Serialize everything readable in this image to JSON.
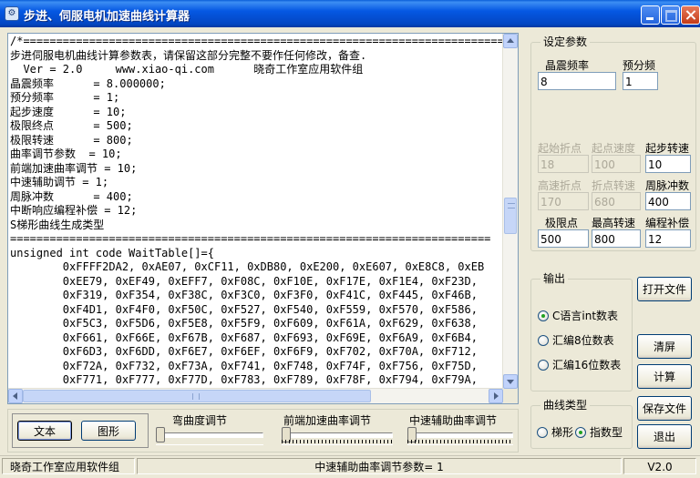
{
  "window": {
    "title": "步进、伺服电机加速曲线计算器"
  },
  "editor": {
    "content": "/*=========================================================================\n步进伺服电机曲线计算参数表，请保留这部分完整不要作任何修改，备查.\n  Ver = 2.0     www.xiao-qi.com      晓奇工作室应用软件组\n晶震频率      = 8.000000;\n预分频率      = 1;\n起步速度      = 10;\n极限终点      = 500;\n极限转速      = 800;\n曲率调节参数  = 10;\n前端加速曲率调节 = 10;\n中速辅助调节 = 1;\n周脉冲数      = 400;\n中断响应编程补偿 = 12;\nS梯形曲线生成类型\n=========================================================================\nunsigned int code WaitTable[]={\n        0xFFFF2DA2, 0xAE07, 0xCF11, 0xDB80, 0xE200, 0xE607, 0xE8C8, 0xEB\n        0xEE79, 0xEF49, 0xEFF7, 0xF08C, 0xF10E, 0xF17E, 0xF1E4, 0xF23D,\n        0xF319, 0xF354, 0xF38C, 0xF3C0, 0xF3F0, 0xF41C, 0xF445, 0xF46B,\n        0xF4D1, 0xF4F0, 0xF50C, 0xF527, 0xF540, 0xF559, 0xF570, 0xF586,\n        0xF5C3, 0xF5D6, 0xF5E8, 0xF5F9, 0xF609, 0xF61A, 0xF629, 0xF638,\n        0xF661, 0xF66E, 0xF67B, 0xF687, 0xF693, 0xF69E, 0xF6A9, 0xF6B4,\n        0xF6D3, 0xF6DD, 0xF6E7, 0xF6EF, 0xF6F9, 0xF702, 0xF70A, 0xF712,\n        0xF72A, 0xF732, 0xF73A, 0xF741, 0xF748, 0xF74F, 0xF756, 0xF75D,\n        0xF771, 0xF777, 0xF77D, 0xF783, 0xF789, 0xF78F, 0xF794, 0xF79A,"
  },
  "settings": {
    "group_label": "设定参数",
    "crystal": {
      "label": "晶震频率",
      "value": "8"
    },
    "prescale": {
      "label": "预分频",
      "value": "1"
    },
    "start_point": {
      "label": "起始折点",
      "value": "18"
    },
    "start_speed": {
      "label": "起点速度",
      "value": "100"
    },
    "step_speed": {
      "label": "起步转速",
      "value": "10"
    },
    "high_point": {
      "label": "高速折点",
      "value": "170"
    },
    "turn_speed": {
      "label": "折点转速",
      "value": "680"
    },
    "pulses": {
      "label": "周脉冲数",
      "value": "400"
    },
    "limit_point": {
      "label": "极限点",
      "value": "500"
    },
    "max_speed": {
      "label": "最高转速",
      "value": "800"
    },
    "compensation": {
      "label": "编程补偿",
      "value": "12"
    }
  },
  "output": {
    "group_label": "输出",
    "options": [
      "C语言int数表",
      "汇编8位数表",
      "汇编16位数表"
    ]
  },
  "curve": {
    "group_label": "曲线类型",
    "options": [
      "梯形",
      "指数型"
    ]
  },
  "buttons": {
    "open_file": "打开文件",
    "clear": "清屏",
    "calculate": "计算",
    "save_file": "保存文件",
    "exit": "退出",
    "text_view": "文本",
    "graph_view": "图形"
  },
  "sliders": {
    "curvature": "弯曲度调节",
    "front_accel": "前端加速曲率调节",
    "mid_assist": "中速辅助曲率调节"
  },
  "status": {
    "org": "晓奇工作室应用软件组",
    "message": "中速辅助曲率调节参数= 1",
    "version": "V2.0"
  }
}
